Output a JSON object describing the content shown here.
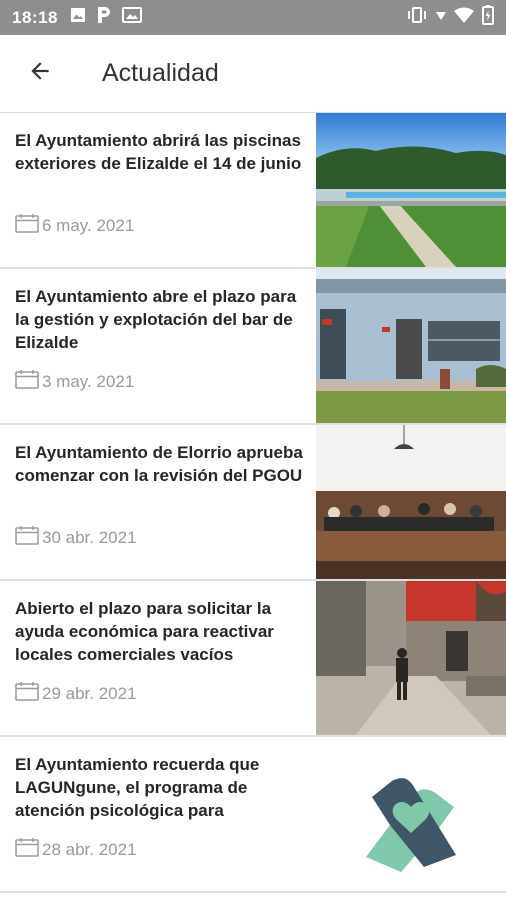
{
  "status_bar": {
    "time": "18:18",
    "left_icons": [
      "image-icon",
      "parking-icon",
      "photo-icon"
    ],
    "right_icons": [
      "vibrate-icon",
      "signal-icon",
      "wifi-icon",
      "battery-icon"
    ]
  },
  "app_bar": {
    "back_icon": "arrow-back-icon",
    "title": "Actualidad"
  },
  "news": [
    {
      "title": "El Ayuntamiento abrirá las piscinas exteriores de Elizalde el 14 de junio",
      "date": "6 may. 2021",
      "image": "pool-photo"
    },
    {
      "title": "El Ayuntamiento abre el plazo para la gestión y explotación del bar de Elizalde",
      "date": "3 may. 2021",
      "image": "building-photo"
    },
    {
      "title": "El Ayuntamiento de Elorrio aprueba comenzar con la revisión del PGOU",
      "date": "30 abr. 2021",
      "image": "meeting-photo"
    },
    {
      "title": "Abierto el plazo para solicitar la ayuda económica para reactivar locales comerciales vacíos",
      "date": "29 abr. 2021",
      "image": "street-photo"
    },
    {
      "title": "El Ayuntamiento recuerda que LAGUNgune, el programa de atención psicológica para",
      "date": "28 abr. 2021",
      "image": "hands-heart-logo"
    }
  ],
  "colors": {
    "status_bar_bg": "#8e8e8e",
    "title_text": "#262626",
    "date_text": "#9a9a9a",
    "divider": "#e0e0e0"
  }
}
